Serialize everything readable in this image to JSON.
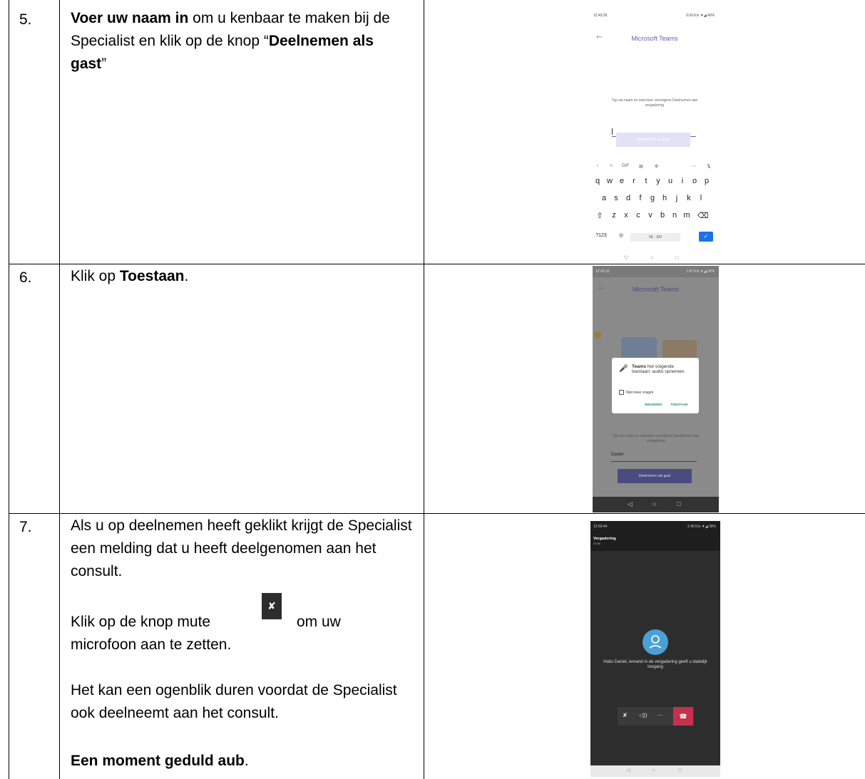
{
  "steps": [
    {
      "number": "5.",
      "text_bold_1": "Voer uw naam in",
      "text_1": " om u kenbaar te maken bij de Specialist en klik op de knop “",
      "text_bold_2": "Deelnemen als gast",
      "text_2": "”"
    },
    {
      "number": "6.",
      "text_1": "Klik op ",
      "text_bold_1": "Toestaan",
      "text_2": "."
    },
    {
      "number": "7.",
      "para_1": "Als u op deelnemen heeft geklikt krijgt de Specialist een melding dat u heeft deelgenomen aan het consult.",
      "para_2a": "Klik op de knop mute",
      "para_2b": "om uw microfoon aan te zetten.",
      "para_3": "Het kan een ogenblik duren voordat de Specialist ook deelneemt aan het consult.",
      "para_4_bold": "Een moment geduld aub",
      "para_4_end": "."
    }
  ],
  "phone1": {
    "time": "12:43:26",
    "status": "0.00 K/s ▼◢ 40%",
    "back": "←",
    "title": "Microsoft Teams",
    "prompt": "Typ uw naam en selecteer vervolgens Deelnemen aan vergadering",
    "button": "Deelnemen als gast",
    "kb_row1": [
      "q",
      "w",
      "e",
      "r",
      "t",
      "y",
      "u",
      "i",
      "o",
      "p"
    ],
    "kb_row2": [
      "a",
      "s",
      "d",
      "f",
      "g",
      "h",
      "j",
      "k",
      "l"
    ],
    "kb_row3": [
      "⇧",
      "z",
      "x",
      "c",
      "v",
      "b",
      "n",
      "m",
      "⌫"
    ],
    "kb_top": [
      "‹",
      "☺",
      "GIF",
      "▤",
      "⚙",
      "⋯",
      "🎙"
    ],
    "kb_mode": "?123",
    "kb_lang": "NL · EN",
    "kb_globe": "◎",
    "kb_enter": "✓",
    "nav": [
      "▽",
      "○",
      "□"
    ]
  },
  "phone2": {
    "time": "12:45:32",
    "status": "1.87 K/s ▼◢ 39%",
    "back": "←",
    "title": "Microsoft Teams",
    "dialog_app": "Teams",
    "dialog_text": " het volgende toestaan: audio opnemen.",
    "dialog_checkbox": "Niet meer vragen",
    "deny": "WEIGEREN",
    "allow": "TOESTAAN",
    "prompt": "Typ uw naam en selecteer vervolgens Deelnemen aan vergadering",
    "name_value": "Daniel",
    "button": "Deelnemen als gast",
    "nav": [
      "◁",
      "○",
      "□"
    ]
  },
  "phone3": {
    "time": "12:50:44",
    "status": "2.40 K/s ▼◢ 39%",
    "header_title": "Vergadering",
    "header_time": "01:56",
    "message": "Hallo Daniel, iemand in de vergadering geeft u dadelijk toegang",
    "ctrl_mute": "✘",
    "ctrl_speaker": "◁))",
    "ctrl_more": "⋯",
    "ctrl_hangup": "☎",
    "nav": [
      "◁",
      "○",
      "□"
    ]
  },
  "mute_icon_glyph": "✘"
}
